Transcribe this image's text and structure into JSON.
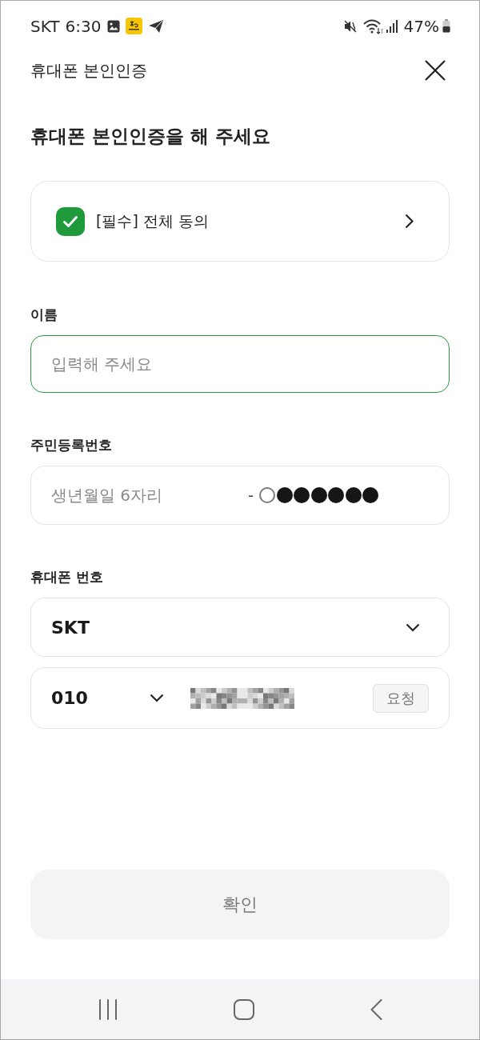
{
  "status_bar": {
    "carrier": "SKT",
    "time": "6:30",
    "battery": "47%"
  },
  "header": {
    "title": "휴대폰 본인인증"
  },
  "heading": "휴대폰 본인인증을 해 주세요",
  "agreement": {
    "label": "[필수] 전체 동의",
    "checked": true
  },
  "name_field": {
    "label": "이름",
    "placeholder": "입력해 주세요",
    "focused": true
  },
  "resident_field": {
    "label": "주민등록번호",
    "placeholder": "생년월일 6자리",
    "separator": "-",
    "digits": [
      {
        "filled": false
      },
      {
        "filled": true
      },
      {
        "filled": true
      },
      {
        "filled": true
      },
      {
        "filled": true
      },
      {
        "filled": true
      },
      {
        "filled": true
      }
    ]
  },
  "phone_field": {
    "label": "휴대폰 번호",
    "carrier": "SKT",
    "prefix": "010",
    "request_button": {
      "label": "요청",
      "disabled": true
    }
  },
  "confirm_button": {
    "label": "확인",
    "disabled": true
  }
}
